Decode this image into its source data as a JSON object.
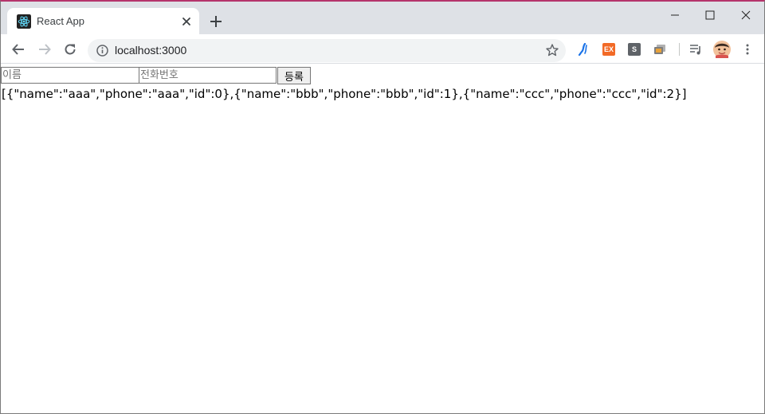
{
  "tab": {
    "title": "React App",
    "favicon": "react-logo-icon",
    "close_icon": "close-icon"
  },
  "new_tab_icon": "plus-icon",
  "window_controls": [
    "minimize-icon",
    "maximize-icon",
    "close-icon"
  ],
  "toolbar": {
    "back_icon": "back-arrow-icon",
    "forward_icon": "forward-arrow-icon",
    "reload_icon": "reload-icon",
    "url": "localhost:3000",
    "info_icon": "info-icon",
    "bookmark_icon": "star-icon",
    "extensions": [
      {
        "name": "stylus-extension-icon",
        "color": "#1a73e8"
      },
      {
        "name": "ex-extension-icon",
        "label": "EX",
        "color": "#f26a27"
      },
      {
        "name": "s-extension-icon",
        "label": "S",
        "color": "#5f6368"
      },
      {
        "name": "cast-extension-icon",
        "color": "#8a8a8a"
      }
    ],
    "media_icon": "media-queue-icon",
    "profile_icon": "avatar",
    "menu_icon": "kebab-menu-icon"
  },
  "form": {
    "name_placeholder": "이름",
    "phone_placeholder": "전화번호",
    "submit_label": "등록"
  },
  "output": "[{\"name\":\"aaa\",\"phone\":\"aaa\",\"id\":0},{\"name\":\"bbb\",\"phone\":\"bbb\",\"id\":1},{\"name\":\"ccc\",\"phone\":\"ccc\",\"id\":2}]",
  "colors": {
    "tabstrip": "#dee1e6",
    "omnibox": "#f1f3f4",
    "accent": "#1a73e8",
    "react": "#61dafb"
  }
}
